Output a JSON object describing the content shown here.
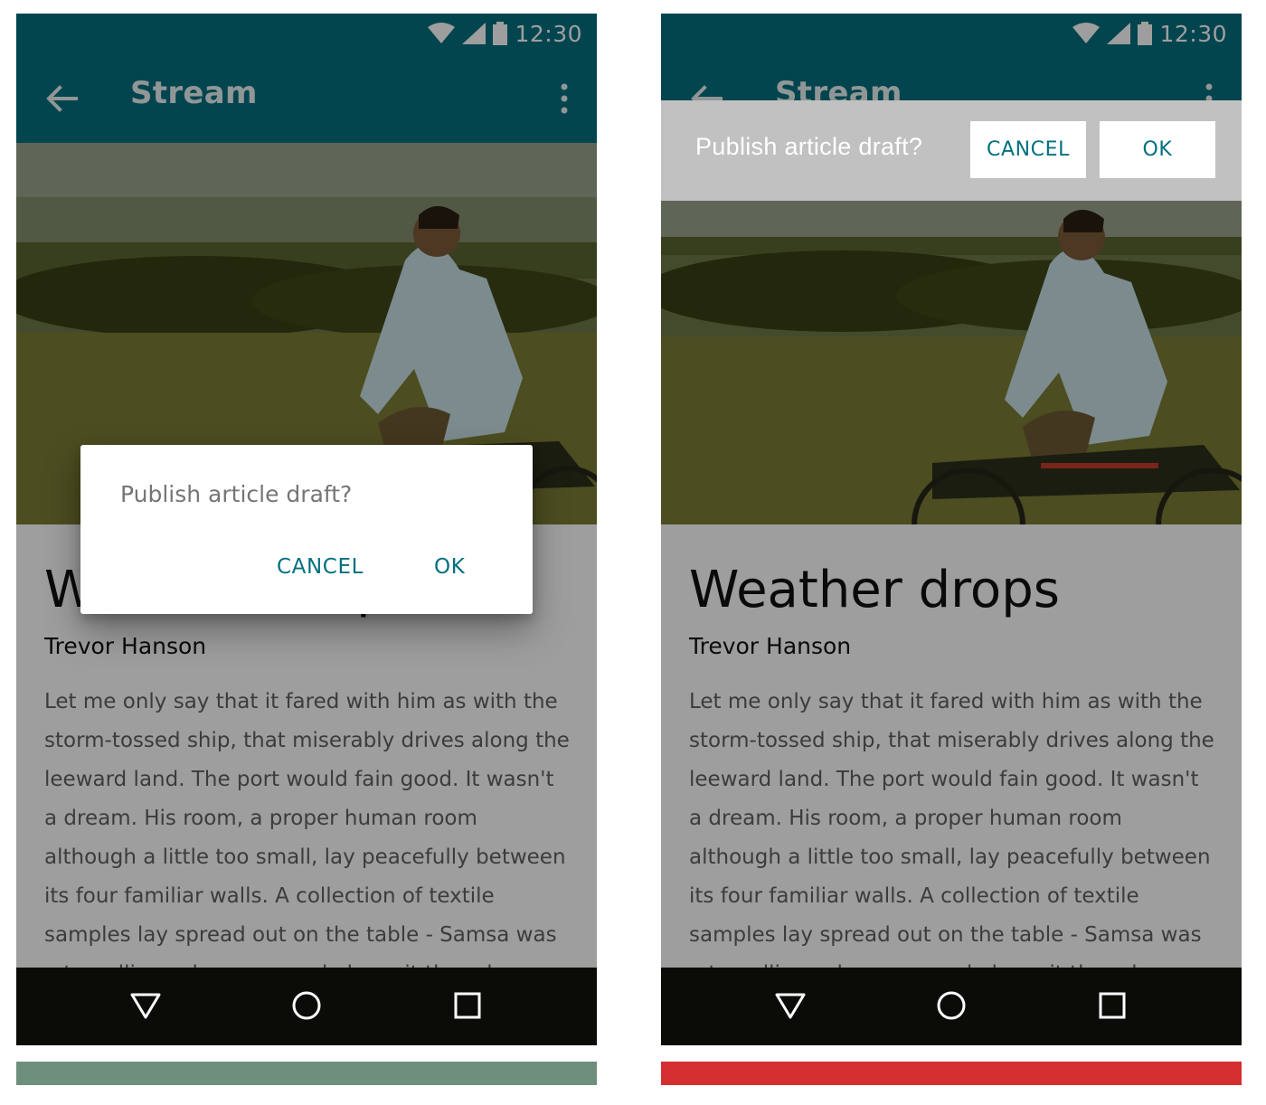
{
  "status_bar": {
    "time": "12:30",
    "icons": [
      "wifi-icon",
      "signal-icon",
      "battery-icon"
    ]
  },
  "app_bar": {
    "title": "Stream",
    "back_icon": "arrow-back-icon",
    "menu_icon": "more-vert-icon"
  },
  "article": {
    "title": "Weather drops",
    "author": "Trevor Hanson",
    "body": "Let me only say that it fared with him as with the storm-tossed ship, that miserably drives along the leeward land. The port would fain good. It wasn't a dream. His room, a proper human room although a little too small, lay peacefully between its four familiar walls. A collection of textile samples lay spread out on the table - Samsa was a travelling salesman - and above it there hung a picture that he"
  },
  "dialog": {
    "message": "Publish article draft?",
    "cancel_label": "CANCEL",
    "ok_label": "OK"
  },
  "banner": {
    "message": "Publish article draft?",
    "cancel_label": "CANCEL",
    "ok_label": "OK"
  },
  "nav_bar": {
    "icons": [
      "nav-back-icon",
      "nav-home-icon",
      "nav-recents-icon"
    ]
  },
  "indicators": {
    "left_color": "#6f8f7d",
    "right_color": "#d32f2f"
  },
  "colors": {
    "primary": "#04707f",
    "scrim": "rgba(0,0,0,0.38)",
    "nav_bar": "#0b0b07"
  }
}
